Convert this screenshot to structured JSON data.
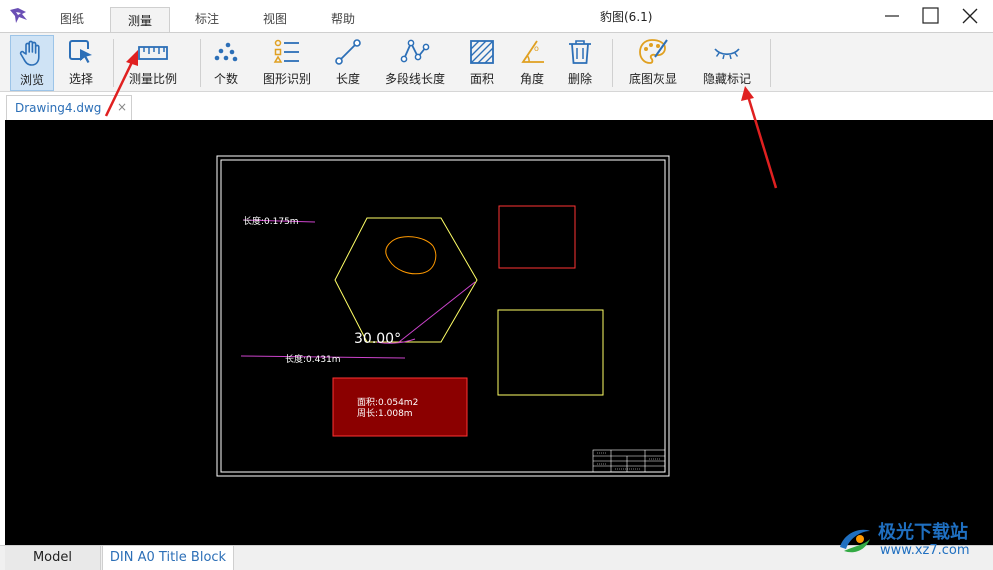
{
  "window": {
    "title": "豹图(6.1)"
  },
  "menu_tabs": [
    "图纸",
    "测量",
    "标注",
    "视图",
    "帮助"
  ],
  "active_menu_tab": "测量",
  "toolbar": {
    "browse": "浏览",
    "select": "选择",
    "measure_scale": "测量比例",
    "count": "个数",
    "shape_recognition": "图形识别",
    "length": "长度",
    "polyline_length": "多段线长度",
    "area": "面积",
    "angle": "角度",
    "delete": "删除",
    "base_gray": "底图灰显",
    "hide_marks": "隐藏标记"
  },
  "document": {
    "tab_name": "Drawing4.dwg",
    "close_glyph": "×"
  },
  "drawing": {
    "length_label_1": "长度:0.175m",
    "length_label_2": "长度:0.431m",
    "angle_label": "30.00°",
    "area_label": "面积:0.054m2",
    "perimeter_label": "周长:1.008m"
  },
  "layout_tabs": {
    "model": "Model",
    "layout": "DIN A0 Title Block"
  },
  "watermark": {
    "name": "极光下载站",
    "url": "www.xz7.com"
  },
  "colors": {
    "accent": "#2c6fb7",
    "canvas": "#000000",
    "hexagon": "#ffff66",
    "red_rect": "#ff3333",
    "measure_line": "#cc44cc",
    "area_fill": "#8b0000",
    "annotation_arrow": "#e02020"
  }
}
